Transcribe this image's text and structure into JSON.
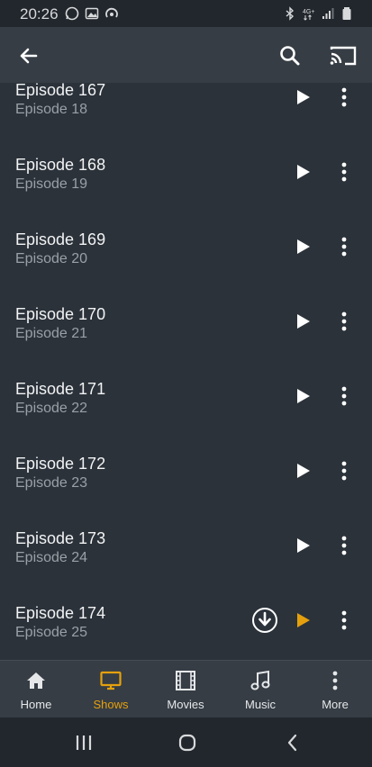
{
  "status_bar": {
    "time": "20:26",
    "left_icons": [
      "whatsapp-icon",
      "gallery-icon",
      "sync-icon"
    ],
    "right_icons": [
      "bluetooth-icon",
      "4g-signal-icon",
      "signal-icon",
      "battery-icon"
    ]
  },
  "app_bar": {
    "back_icon": "arrow-left-icon",
    "search_icon": "search-icon",
    "cast_icon": "cast-icon"
  },
  "episodes": [
    {
      "title": "Episode 167",
      "subtitle": "Episode 18",
      "downloadable": false,
      "accent": false
    },
    {
      "title": "Episode 168",
      "subtitle": "Episode 19",
      "downloadable": false,
      "accent": false
    },
    {
      "title": "Episode 169",
      "subtitle": "Episode 20",
      "downloadable": false,
      "accent": false
    },
    {
      "title": "Episode 170",
      "subtitle": "Episode 21",
      "downloadable": false,
      "accent": false
    },
    {
      "title": "Episode 171",
      "subtitle": "Episode 22",
      "downloadable": false,
      "accent": false
    },
    {
      "title": "Episode 172",
      "subtitle": "Episode 23",
      "downloadable": false,
      "accent": false
    },
    {
      "title": "Episode 173",
      "subtitle": "Episode 24",
      "downloadable": false,
      "accent": false
    },
    {
      "title": "Episode 174",
      "subtitle": "Episode 25",
      "downloadable": true,
      "accent": true
    }
  ],
  "bottom_nav": [
    {
      "label": "Home",
      "icon": "home-icon",
      "active": false
    },
    {
      "label": "Shows",
      "icon": "tv-icon",
      "active": true
    },
    {
      "label": "Movies",
      "icon": "film-icon",
      "active": false
    },
    {
      "label": "Music",
      "icon": "music-note-icon",
      "active": false
    },
    {
      "label": "More",
      "icon": "more-vertical-icon",
      "active": false
    }
  ],
  "colors": {
    "background": "#2b323a",
    "bar": "#363d45",
    "accent": "#e5a00d",
    "subtitle": "#9aa0a6"
  }
}
